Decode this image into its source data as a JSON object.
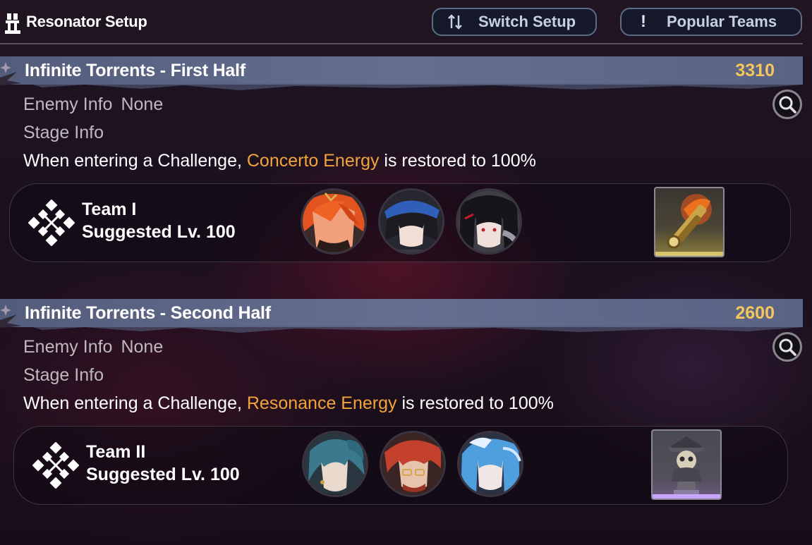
{
  "header": {
    "title": "Resonator Setup",
    "switch_setup_label": "Switch Setup",
    "popular_teams_label": "Popular Teams",
    "popular_icon_glyph": "!",
    "switch_icon": "swap-arrows-icon"
  },
  "sections": [
    {
      "title": "Infinite Torrents - First Half",
      "score": "3310",
      "enemy_info_label": "Enemy Info",
      "enemy_info_value": "None",
      "stage_info_label": "Stage Info",
      "desc_prefix": "When entering a Challenge, ",
      "desc_highlight": "Concerto Energy",
      "desc_suffix": " is restored to 100%",
      "team_name": "Team I",
      "suggested_level": "Suggested Lv. 100",
      "echo_item": "golden-spyglass-icon",
      "avatars": [
        "resonator-red-hair",
        "resonator-blue-cap",
        "resonator-black-hair"
      ]
    },
    {
      "title": "Infinite Torrents - Second Half",
      "score": "2600",
      "enemy_info_label": "Enemy Info",
      "enemy_info_value": "None",
      "stage_info_label": "Stage Info",
      "desc_prefix": "When entering a Challenge, ",
      "desc_highlight": "Resonance Energy",
      "desc_suffix": " is restored to 100%",
      "team_name": "Team II",
      "suggested_level": "Suggested Lv. 100",
      "echo_item": "pirate-skull-bust-icon",
      "avatars": [
        "resonator-teal-ponytail",
        "resonator-red-glasses",
        "resonator-blue-hair"
      ]
    }
  ],
  "colors": {
    "score": "#f5c75a",
    "highlight": "#f2a33a",
    "header_band": "#64709a"
  }
}
